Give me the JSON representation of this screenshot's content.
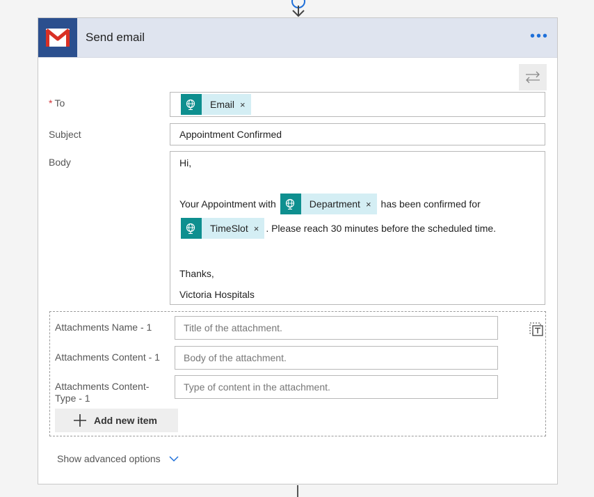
{
  "action": {
    "title": "Send email",
    "logo_icon": "gmail-icon",
    "more_icon": "more-icon"
  },
  "to": {
    "label": "To",
    "required_mark": "*",
    "token": {
      "label": "Email",
      "close": "×"
    }
  },
  "subject": {
    "label": "Subject",
    "value": "Appointment Confirmed"
  },
  "body": {
    "label": "Body",
    "greeting": "Hi,",
    "line1_prefix": "Your Appointment with",
    "token_department": {
      "label": "Department",
      "close": "×"
    },
    "line1_suffix": "has been confirmed for",
    "token_timeslot": {
      "label": "TimeSlot",
      "close": "×"
    },
    "line2_suffix": ". Please reach 30 minutes before the scheduled time.",
    "closing": "Thanks,",
    "signature": "Victoria Hospitals"
  },
  "attachments": {
    "name_label": "Attachments Name - 1",
    "name_placeholder": "Title of the attachment.",
    "content_label": "Attachments Content - 1",
    "content_placeholder": "Body of the attachment.",
    "type_label": "Attachments Content-Type - 1",
    "type_placeholder": "Type of content in the attachment.",
    "add_label": "Add new item"
  },
  "advanced": {
    "label": "Show advanced options"
  },
  "colors": {
    "accent": "#1e6fd9",
    "token_bg": "#d4eef4",
    "token_icon_bg": "#0e8f8f",
    "header_bg": "#dfe4ef"
  }
}
